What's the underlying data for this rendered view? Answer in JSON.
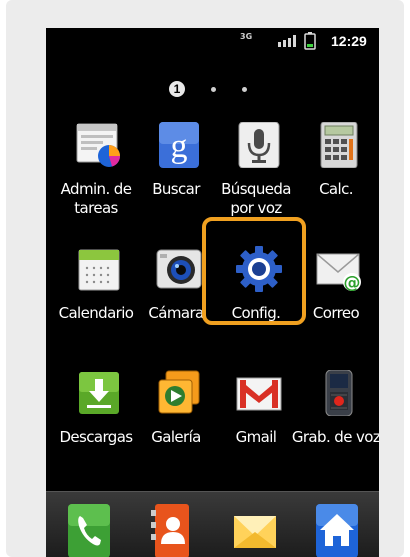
{
  "status_bar": {
    "network": "3G",
    "time": "12:29"
  },
  "page_indicator": {
    "current": "1"
  },
  "apps": [
    {
      "label": "Admin. de tareas",
      "icon": "task-manager-icon"
    },
    {
      "label": "Buscar",
      "icon": "google-search-icon"
    },
    {
      "label": "Búsqueda por voz",
      "icon": "microphone-icon"
    },
    {
      "label": "Calc.",
      "icon": "calculator-icon"
    },
    {
      "label": "Calendario",
      "icon": "calendar-icon"
    },
    {
      "label": "Cámara",
      "icon": "camera-icon"
    },
    {
      "label": "Config.",
      "icon": "gear-icon"
    },
    {
      "label": "Correo",
      "icon": "email-icon"
    },
    {
      "label": "Descargas",
      "icon": "download-icon"
    },
    {
      "label": "Galería",
      "icon": "gallery-icon"
    },
    {
      "label": "Gmail",
      "icon": "gmail-icon"
    },
    {
      "label": "Grab. de voz",
      "icon": "voice-recorder-icon"
    }
  ],
  "dock": [
    {
      "icon": "phone-icon"
    },
    {
      "icon": "contacts-icon"
    },
    {
      "icon": "messaging-icon"
    },
    {
      "icon": "home-icon"
    }
  ],
  "colors": {
    "highlight": "#f0a020",
    "screen_background": "#000000"
  }
}
